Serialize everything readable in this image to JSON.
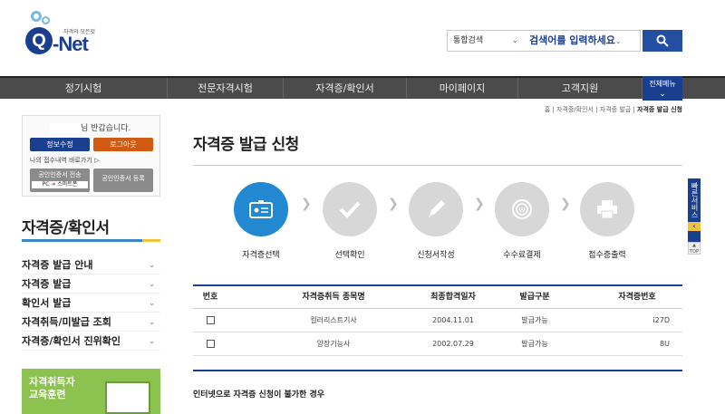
{
  "header": {
    "logo_text": "Q-Net",
    "logo_tagline": "자격의 모든것",
    "search_scope": "통합검색",
    "search_placeholder": "검색어를 입력하세요"
  },
  "gnb": {
    "items": [
      {
        "label": "정기시험"
      },
      {
        "label": "전문자격시험"
      },
      {
        "label": "자격증/확인서"
      },
      {
        "label": "마이페이지"
      },
      {
        "label": "고객지원"
      }
    ],
    "all_menu": "전체메뉴"
  },
  "login": {
    "greeting_suffix": "님 반갑습니다.",
    "edit_info": "정보수정",
    "logout": "로그아웃",
    "shortcut": "나의 접수내역 바로가기",
    "cert_send": "공인인증서 전송",
    "pc_label": "PC",
    "smartphone": "스마트폰",
    "cert_register": "공인인증서 등록"
  },
  "sidebar": {
    "title": "자격증/확인서",
    "items": [
      {
        "label": "자격증 발급 안내"
      },
      {
        "label": "자격증 발급"
      },
      {
        "label": "확인서 발급"
      },
      {
        "label": "자격취득/미발급 조회"
      },
      {
        "label": "자격증/확인서 진위확인"
      }
    ],
    "banner_line1": "자격취득자",
    "banner_line2": "교육훈련"
  },
  "breadcrumb": {
    "home": "홈",
    "level1": "자격증/확인서",
    "level2": "자격증 발급",
    "current": "자격증 발급 신청"
  },
  "page_title": "자격증 발급 신청",
  "steps": [
    {
      "label": "자격증선택",
      "icon": "id-card-icon",
      "active": true
    },
    {
      "label": "선택확인",
      "icon": "check-icon",
      "active": false
    },
    {
      "label": "신청서작성",
      "icon": "pencil-icon",
      "active": false
    },
    {
      "label": "수수료결제",
      "icon": "coin-icon",
      "active": false
    },
    {
      "label": "접수증출력",
      "icon": "printer-icon",
      "active": false
    }
  ],
  "table": {
    "headers": [
      "번호",
      "자격증취득 종목명",
      "최종합격일자",
      "발급구분",
      "자격증번호"
    ],
    "rows": [
      {
        "name": "컬러리스트기사",
        "date": "2004.11.01",
        "status": "발급가능",
        "number": "i27D"
      },
      {
        "name": "양장기능사",
        "date": "2002.07.29",
        "status": "발급가능",
        "number": "8U"
      }
    ]
  },
  "notice_title": "인터넷으로 자격증 신청이 불가한 경우",
  "quick_menu": {
    "label": "빠른서비스",
    "top": "TOP"
  },
  "colors": {
    "brand": "#1b3f8f",
    "active_step": "#2188d1",
    "logout_btn": "#d15a12",
    "banner": "#8bc250"
  }
}
